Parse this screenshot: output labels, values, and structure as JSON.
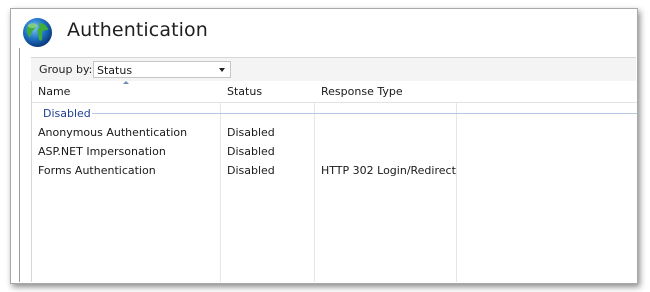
{
  "header": {
    "title": "Authentication",
    "icon": "globe-icon"
  },
  "toolbar": {
    "group_by_label": "Group by:",
    "group_by_value": "Status"
  },
  "list": {
    "columns": [
      "Name",
      "Status",
      "Response Type"
    ],
    "sorted_column": "Name",
    "group": "Disabled",
    "rows": [
      {
        "name": "Anonymous Authentication",
        "status": "Disabled",
        "response_type": ""
      },
      {
        "name": "ASP.NET Impersonation",
        "status": "Disabled",
        "response_type": ""
      },
      {
        "name": "Forms Authentication",
        "status": "Disabled",
        "response_type": "HTTP 302 Login/Redirect"
      }
    ]
  },
  "colors": {
    "group_header": "#1e3f93",
    "group_line": "#b6c8e2",
    "sort_arrow": "#6f8db3"
  }
}
